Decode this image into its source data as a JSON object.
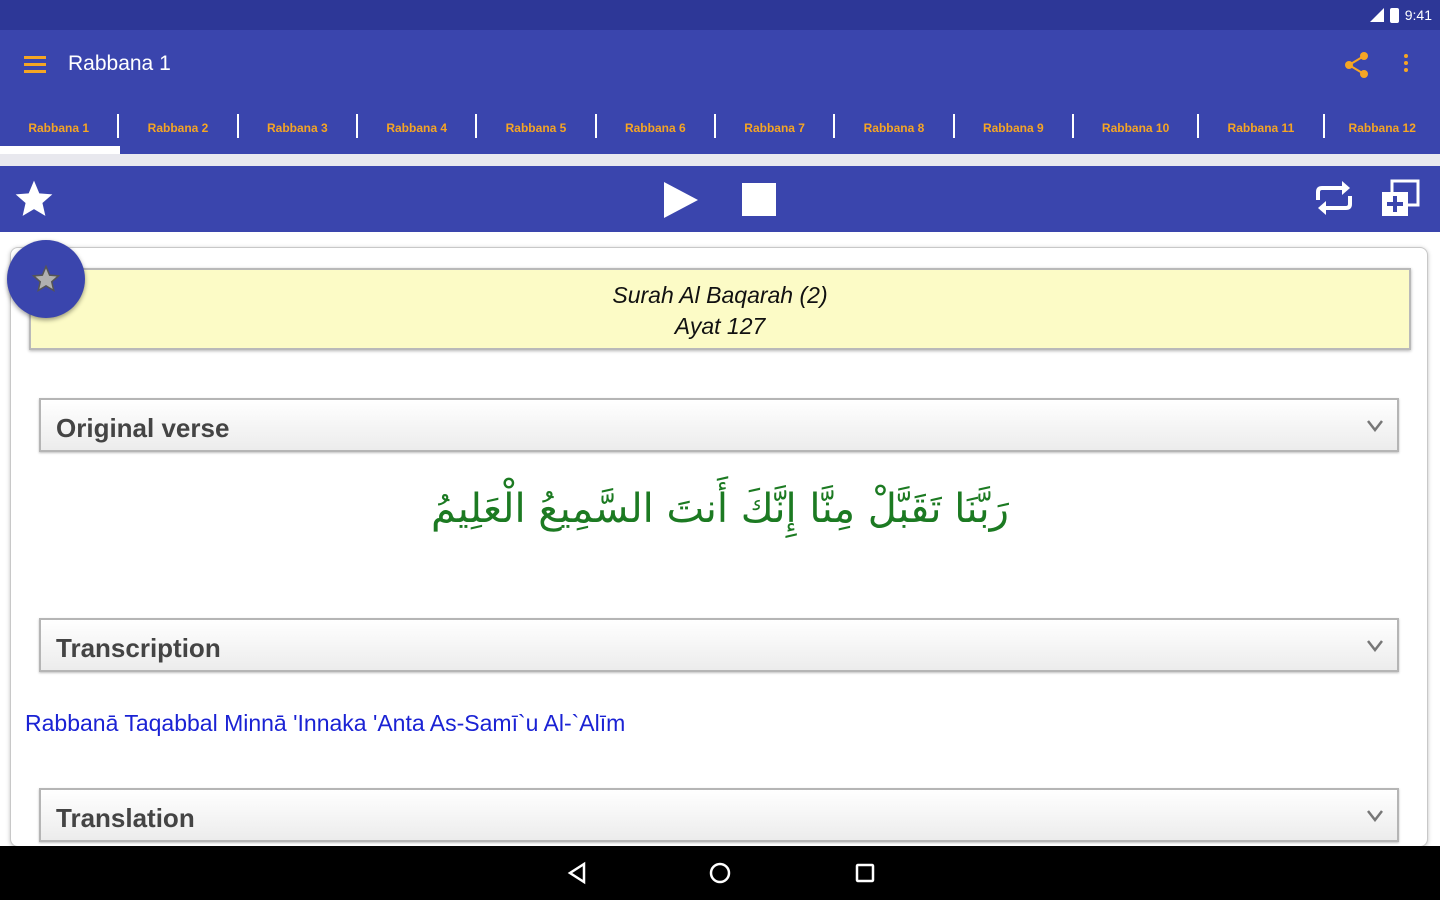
{
  "status_bar": {
    "time": "9:41"
  },
  "toolbar": {
    "title": "Rabbana 1"
  },
  "tabs": [
    {
      "label": "Rabbana 1",
      "selected": true
    },
    {
      "label": "Rabbana 2"
    },
    {
      "label": "Rabbana 3"
    },
    {
      "label": "Rabbana 4"
    },
    {
      "label": "Rabbana 5"
    },
    {
      "label": "Rabbana 6"
    },
    {
      "label": "Rabbana 7"
    },
    {
      "label": "Rabbana 8"
    },
    {
      "label": "Rabbana 9"
    },
    {
      "label": "Rabbana 10"
    },
    {
      "label": "Rabbana 11"
    },
    {
      "label": "Rabbana 12"
    }
  ],
  "surah": {
    "title": "Surah Al Baqarah (2)",
    "ayat": "Ayat 127"
  },
  "sections": {
    "original": {
      "label": "Original verse",
      "arabic": "رَبَّنَا تَقَبَّلْ مِنَّا إِنَّكَ أَنتَ السَّمِيعُ الْعَلِيمُ"
    },
    "transcription": {
      "label": "Transcription",
      "text": "Rabbanā Taqabbal Minnā 'Innaka 'Anta As-Samī`u Al-`Alīm"
    },
    "translation": {
      "label": "Translation"
    }
  },
  "colors": {
    "primary": "#3a45ad",
    "accent": "#f5a524",
    "arabic_text": "#1c7a22",
    "transcription_text": "#1a22d4",
    "surah_box": "#fcfbc6"
  },
  "icons": {
    "menu": "hamburger-icon",
    "share": "share-icon",
    "more": "more-vert-icon",
    "favorite": "star-icon",
    "play": "play-icon",
    "stop": "stop-icon",
    "repeat": "repeat-icon",
    "add_window": "add-window-icon",
    "expand": "chevron-down-icon",
    "nav_back": "back-icon",
    "nav_home": "home-icon",
    "nav_recent": "recents-icon"
  }
}
